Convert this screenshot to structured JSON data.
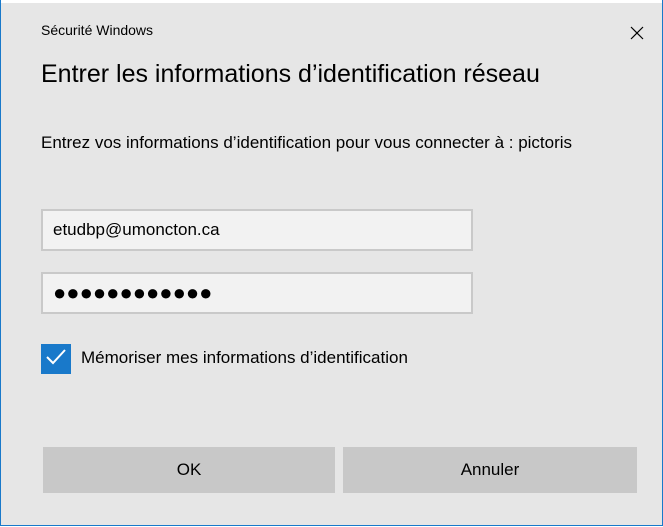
{
  "window": {
    "title": "Sécurité Windows",
    "close_icon": "close-icon",
    "accent_color": "#1979ca"
  },
  "dialog": {
    "heading": "Entrer les informations d’identification réseau",
    "message": "Entrez vos informations d’identification pour vous connecter à : pictoris"
  },
  "form": {
    "username_value": "etudbp@umoncton.ca",
    "password_mask": "●●●●●●●●●●●●",
    "remember_checked": true,
    "remember_label": "Mémoriser mes informations d’identification"
  },
  "buttons": {
    "ok_label": "OK",
    "cancel_label": "Annuler"
  }
}
